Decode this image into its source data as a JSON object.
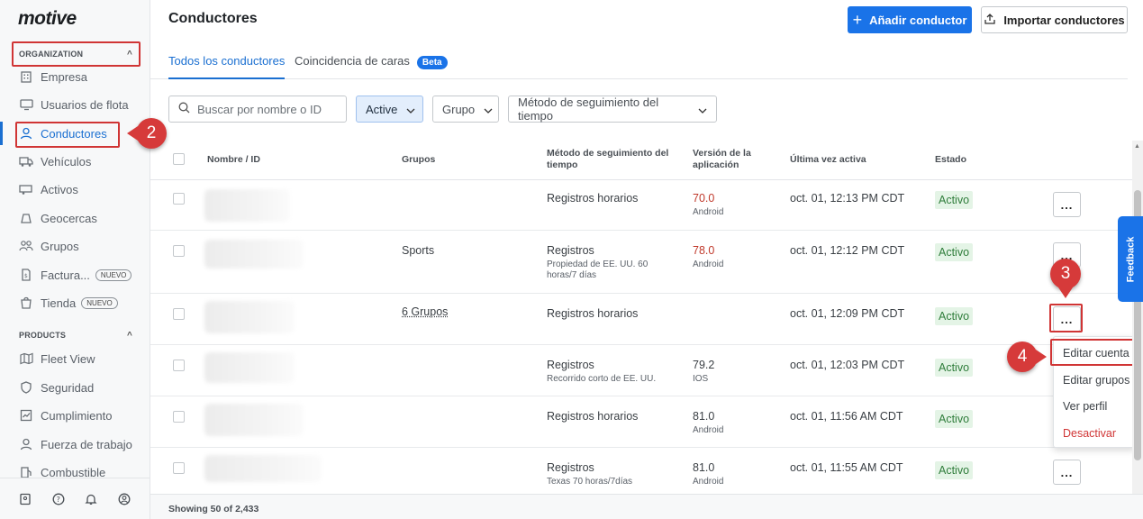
{
  "brand": {
    "logo": "motive"
  },
  "sidebar": {
    "organization_header": "ORGANIZATION",
    "products_header": "PRODUCTS",
    "org_items": [
      {
        "label": "Empresa",
        "icon": "building-icon"
      },
      {
        "label": "Usuarios de flota",
        "icon": "monitor-icon"
      },
      {
        "label": "Conductores",
        "icon": "user-icon",
        "active": true
      },
      {
        "label": "Vehículos",
        "icon": "truck-icon"
      },
      {
        "label": "Activos",
        "icon": "trailer-icon"
      },
      {
        "label": "Geocercas",
        "icon": "geofence-icon"
      },
      {
        "label": "Grupos",
        "icon": "groups-icon"
      },
      {
        "label": "Factura...",
        "icon": "invoice-icon",
        "badge": "NUEVO"
      },
      {
        "label": "Tienda",
        "icon": "store-icon",
        "badge": "NUEVO"
      }
    ],
    "product_items": [
      {
        "label": "Fleet View",
        "icon": "map-icon"
      },
      {
        "label": "Seguridad",
        "icon": "shield-icon"
      },
      {
        "label": "Cumplimiento",
        "icon": "compliance-icon"
      },
      {
        "label": "Fuerza de trabajo",
        "icon": "person-icon"
      },
      {
        "label": "Combustible",
        "icon": "fuel-icon"
      }
    ]
  },
  "header": {
    "title": "Conductores",
    "add_button": "Añadir conductor",
    "import_button": "Importar conductores"
  },
  "tabs": {
    "all": "Todos los conductores",
    "face": "Coincidencia de caras",
    "beta": "Beta"
  },
  "filters": {
    "search_placeholder": "Buscar por nombre o ID",
    "status": "Active",
    "group": "Grupo",
    "method": "Método de seguimiento del tiempo"
  },
  "table": {
    "columns": {
      "name": "Nombre / ID",
      "groups": "Grupos",
      "method": "Método de seguimiento del tiempo",
      "version": "Versión de la aplicación",
      "last_active": "Última vez activa",
      "status": "Estado"
    },
    "rows": [
      {
        "group": "",
        "method": "Registros horarios",
        "method_sub": "",
        "version": "70.0",
        "platform": "Android",
        "outdated": true,
        "last_active": "oct. 01, 12:13 PM CDT",
        "status": "Activo"
      },
      {
        "group": "Sports",
        "method": "Registros",
        "method_sub": "Propiedad de EE. UU. 60 horas/7 días",
        "version": "78.0",
        "platform": "Android",
        "outdated": true,
        "last_active": "oct. 01, 12:12 PM CDT",
        "status": "Activo"
      },
      {
        "group": "6 Grupos",
        "method": "Registros horarios",
        "method_sub": "",
        "version": "",
        "platform": "",
        "outdated": false,
        "last_active": "oct. 01, 12:09 PM CDT",
        "status": "Activo"
      },
      {
        "group": "",
        "method": "Registros",
        "method_sub": "Recorrido corto de EE. UU.",
        "version": "79.2",
        "platform": "IOS",
        "outdated": false,
        "last_active": "oct. 01, 12:03 PM CDT",
        "status": "Activo"
      },
      {
        "group": "",
        "method": "Registros horarios",
        "method_sub": "",
        "version": "81.0",
        "platform": "Android",
        "outdated": false,
        "last_active": "oct. 01, 11:56 AM CDT",
        "status": "Activo"
      },
      {
        "group": "",
        "method": "Registros",
        "method_sub": "Texas 70 horas/7días",
        "version": "81.0",
        "platform": "Android",
        "outdated": false,
        "last_active": "oct. 01, 11:55 AM CDT",
        "status": "Activo"
      }
    ],
    "row_menu_label": "..."
  },
  "row_menu": {
    "edit_account": "Editar cuenta",
    "edit_groups": "Editar grupos",
    "view_profile": "Ver perfil",
    "deactivate": "Desactivar"
  },
  "feedback": "Feedback",
  "footer": "Showing 50 of 2,433",
  "annotations": [
    "2",
    "3",
    "4"
  ],
  "colors": {
    "accent": "#1a73e8",
    "annotation": "#d63a3a",
    "status_bg": "#e4f4e6",
    "danger": "#d03535"
  }
}
